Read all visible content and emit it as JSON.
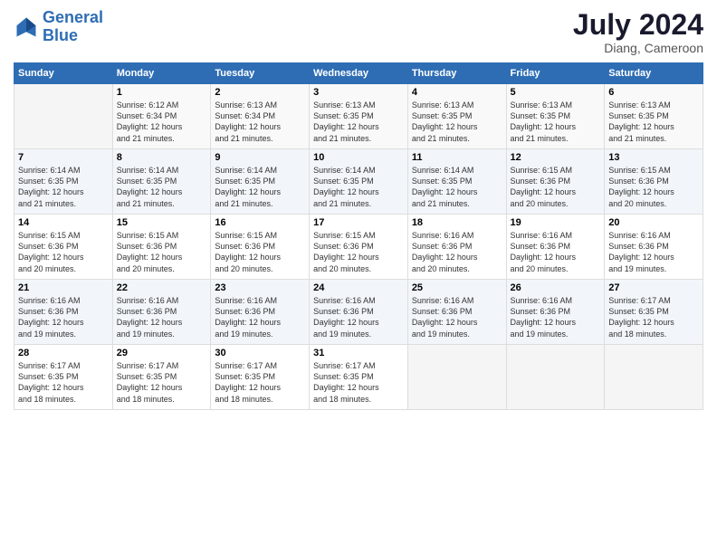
{
  "header": {
    "logo_line1": "General",
    "logo_line2": "Blue",
    "title": "July 2024",
    "subtitle": "Diang, Cameroon"
  },
  "calendar": {
    "days_of_week": [
      "Sunday",
      "Monday",
      "Tuesday",
      "Wednesday",
      "Thursday",
      "Friday",
      "Saturday"
    ],
    "weeks": [
      [
        {
          "day": "",
          "info": ""
        },
        {
          "day": "1",
          "info": "Sunrise: 6:12 AM\nSunset: 6:34 PM\nDaylight: 12 hours\nand 21 minutes."
        },
        {
          "day": "2",
          "info": "Sunrise: 6:13 AM\nSunset: 6:34 PM\nDaylight: 12 hours\nand 21 minutes."
        },
        {
          "day": "3",
          "info": "Sunrise: 6:13 AM\nSunset: 6:35 PM\nDaylight: 12 hours\nand 21 minutes."
        },
        {
          "day": "4",
          "info": "Sunrise: 6:13 AM\nSunset: 6:35 PM\nDaylight: 12 hours\nand 21 minutes."
        },
        {
          "day": "5",
          "info": "Sunrise: 6:13 AM\nSunset: 6:35 PM\nDaylight: 12 hours\nand 21 minutes."
        },
        {
          "day": "6",
          "info": "Sunrise: 6:13 AM\nSunset: 6:35 PM\nDaylight: 12 hours\nand 21 minutes."
        }
      ],
      [
        {
          "day": "7",
          "info": "Sunrise: 6:14 AM\nSunset: 6:35 PM\nDaylight: 12 hours\nand 21 minutes."
        },
        {
          "day": "8",
          "info": "Sunrise: 6:14 AM\nSunset: 6:35 PM\nDaylight: 12 hours\nand 21 minutes."
        },
        {
          "day": "9",
          "info": "Sunrise: 6:14 AM\nSunset: 6:35 PM\nDaylight: 12 hours\nand 21 minutes."
        },
        {
          "day": "10",
          "info": "Sunrise: 6:14 AM\nSunset: 6:35 PM\nDaylight: 12 hours\nand 21 minutes."
        },
        {
          "day": "11",
          "info": "Sunrise: 6:14 AM\nSunset: 6:35 PM\nDaylight: 12 hours\nand 21 minutes."
        },
        {
          "day": "12",
          "info": "Sunrise: 6:15 AM\nSunset: 6:36 PM\nDaylight: 12 hours\nand 20 minutes."
        },
        {
          "day": "13",
          "info": "Sunrise: 6:15 AM\nSunset: 6:36 PM\nDaylight: 12 hours\nand 20 minutes."
        }
      ],
      [
        {
          "day": "14",
          "info": "Sunrise: 6:15 AM\nSunset: 6:36 PM\nDaylight: 12 hours\nand 20 minutes."
        },
        {
          "day": "15",
          "info": "Sunrise: 6:15 AM\nSunset: 6:36 PM\nDaylight: 12 hours\nand 20 minutes."
        },
        {
          "day": "16",
          "info": "Sunrise: 6:15 AM\nSunset: 6:36 PM\nDaylight: 12 hours\nand 20 minutes."
        },
        {
          "day": "17",
          "info": "Sunrise: 6:15 AM\nSunset: 6:36 PM\nDaylight: 12 hours\nand 20 minutes."
        },
        {
          "day": "18",
          "info": "Sunrise: 6:16 AM\nSunset: 6:36 PM\nDaylight: 12 hours\nand 20 minutes."
        },
        {
          "day": "19",
          "info": "Sunrise: 6:16 AM\nSunset: 6:36 PM\nDaylight: 12 hours\nand 20 minutes."
        },
        {
          "day": "20",
          "info": "Sunrise: 6:16 AM\nSunset: 6:36 PM\nDaylight: 12 hours\nand 19 minutes."
        }
      ],
      [
        {
          "day": "21",
          "info": "Sunrise: 6:16 AM\nSunset: 6:36 PM\nDaylight: 12 hours\nand 19 minutes."
        },
        {
          "day": "22",
          "info": "Sunrise: 6:16 AM\nSunset: 6:36 PM\nDaylight: 12 hours\nand 19 minutes."
        },
        {
          "day": "23",
          "info": "Sunrise: 6:16 AM\nSunset: 6:36 PM\nDaylight: 12 hours\nand 19 minutes."
        },
        {
          "day": "24",
          "info": "Sunrise: 6:16 AM\nSunset: 6:36 PM\nDaylight: 12 hours\nand 19 minutes."
        },
        {
          "day": "25",
          "info": "Sunrise: 6:16 AM\nSunset: 6:36 PM\nDaylight: 12 hours\nand 19 minutes."
        },
        {
          "day": "26",
          "info": "Sunrise: 6:16 AM\nSunset: 6:36 PM\nDaylight: 12 hours\nand 19 minutes."
        },
        {
          "day": "27",
          "info": "Sunrise: 6:17 AM\nSunset: 6:35 PM\nDaylight: 12 hours\nand 18 minutes."
        }
      ],
      [
        {
          "day": "28",
          "info": "Sunrise: 6:17 AM\nSunset: 6:35 PM\nDaylight: 12 hours\nand 18 minutes."
        },
        {
          "day": "29",
          "info": "Sunrise: 6:17 AM\nSunset: 6:35 PM\nDaylight: 12 hours\nand 18 minutes."
        },
        {
          "day": "30",
          "info": "Sunrise: 6:17 AM\nSunset: 6:35 PM\nDaylight: 12 hours\nand 18 minutes."
        },
        {
          "day": "31",
          "info": "Sunrise: 6:17 AM\nSunset: 6:35 PM\nDaylight: 12 hours\nand 18 minutes."
        },
        {
          "day": "",
          "info": ""
        },
        {
          "day": "",
          "info": ""
        },
        {
          "day": "",
          "info": ""
        }
      ]
    ]
  }
}
